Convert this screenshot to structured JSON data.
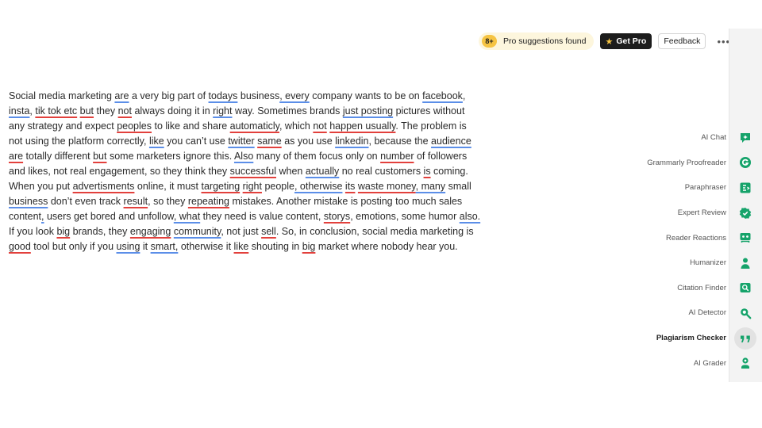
{
  "topbar": {
    "pro_count": "8+",
    "pro_text": "Pro suggestions found",
    "get_pro": "Get Pro",
    "feedback": "Feedback",
    "more": "•••"
  },
  "document": {
    "lines": [
      [
        {
          "t": "Social media marketing "
        },
        {
          "t": "are",
          "u": "b"
        },
        {
          "t": " a very big part of "
        },
        {
          "t": "todays",
          "u": "b"
        },
        {
          "t": " business"
        },
        {
          "t": ", every",
          "u": "b"
        },
        {
          "t": " company wants to be on "
        },
        {
          "t": "facebook",
          "u": "b"
        },
        {
          "t": ","
        }
      ],
      [
        {
          "t": "insta",
          "u": "b"
        },
        {
          "t": ", "
        },
        {
          "t": "tik tok etc",
          "u": "r"
        },
        {
          "t": " "
        },
        {
          "t": "but",
          "u": "r"
        },
        {
          "t": " they "
        },
        {
          "t": "not",
          "u": "r"
        },
        {
          "t": " always doing it in "
        },
        {
          "t": "right",
          "u": "b"
        },
        {
          "t": " way. Sometimes brands "
        },
        {
          "t": "just posting",
          "u": "b"
        },
        {
          "t": " pictures without"
        }
      ],
      [
        {
          "t": "any strategy and expect "
        },
        {
          "t": "peoples",
          "u": "r"
        },
        {
          "t": " to like and share "
        },
        {
          "t": "automaticly",
          "u": "r"
        },
        {
          "t": ", which "
        },
        {
          "t": "not",
          "u": "r"
        },
        {
          "t": " "
        },
        {
          "t": "happen usually",
          "u": "r"
        },
        {
          "t": ". The problem is"
        }
      ],
      [
        {
          "t": "not using the platform correctly, "
        },
        {
          "t": "like",
          "u": "b"
        },
        {
          "t": " you can’t use "
        },
        {
          "t": "twitter",
          "u": "b"
        },
        {
          "t": " "
        },
        {
          "t": "same",
          "u": "r"
        },
        {
          "t": " as you use "
        },
        {
          "t": "linkedin",
          "u": "b"
        },
        {
          "t": ", because the "
        },
        {
          "t": "audience",
          "u": "b"
        }
      ],
      [
        {
          "t": "are",
          "u": "r"
        },
        {
          "t": " totally different "
        },
        {
          "t": "but",
          "u": "r"
        },
        {
          "t": " some marketers ignore this. "
        },
        {
          "t": "Also",
          "u": "b"
        },
        {
          "t": " many of them focus only on "
        },
        {
          "t": "number",
          "u": "r"
        },
        {
          "t": " of followers"
        }
      ],
      [
        {
          "t": "and likes, not real engagement, so they think they "
        },
        {
          "t": "successful",
          "u": "r"
        },
        {
          "t": " when "
        },
        {
          "t": "actually",
          "u": "b"
        },
        {
          "t": " no real customers "
        },
        {
          "t": "is",
          "u": "r"
        },
        {
          "t": " coming."
        }
      ],
      [
        {
          "t": "When you put "
        },
        {
          "t": "advertisments",
          "u": "r"
        },
        {
          "t": " online, it must "
        },
        {
          "t": "targeting",
          "u": "r"
        },
        {
          "t": " "
        },
        {
          "t": "right",
          "u": "r"
        },
        {
          "t": " people"
        },
        {
          "t": ", otherwise",
          "u": "b"
        },
        {
          "t": " "
        },
        {
          "t": "its",
          "u": "r"
        },
        {
          "t": " "
        },
        {
          "t": "waste money",
          "u": "r"
        },
        {
          "t": ", many",
          "u": "b"
        },
        {
          "t": " small"
        }
      ],
      [
        {
          "t": "business",
          "u": "b"
        },
        {
          "t": " don’t even track "
        },
        {
          "t": "result",
          "u": "r"
        },
        {
          "t": ", so they "
        },
        {
          "t": "repeating",
          "u": "r"
        },
        {
          "t": " mistakes. Another mistake is posting too much sales"
        }
      ],
      [
        {
          "t": "content"
        },
        {
          "t": ",",
          "u": "b"
        },
        {
          "t": " users get bored and unfollow"
        },
        {
          "t": ", what",
          "u": "b"
        },
        {
          "t": " they need is value content, "
        },
        {
          "t": "storys",
          "u": "r"
        },
        {
          "t": ", emotions, some humor "
        },
        {
          "t": "also.",
          "u": "b"
        }
      ],
      [
        {
          "t": "If you look "
        },
        {
          "t": "big",
          "u": "r"
        },
        {
          "t": " brands, they "
        },
        {
          "t": "engaging",
          "u": "r"
        },
        {
          "t": " "
        },
        {
          "t": "community",
          "u": "b"
        },
        {
          "t": ", not just "
        },
        {
          "t": "sell",
          "u": "r"
        },
        {
          "t": ". So, in conclusion, social media marketing is"
        }
      ],
      [
        {
          "t": "good",
          "u": "r"
        },
        {
          "t": " tool but only if you "
        },
        {
          "t": "using",
          "u": "b"
        },
        {
          "t": " it "
        },
        {
          "t": "smart,",
          "u": "b"
        },
        {
          "t": " otherwise it "
        },
        {
          "t": "like",
          "u": "r"
        },
        {
          "t": " shouting in "
        },
        {
          "t": "big",
          "u": "r"
        },
        {
          "t": " market where nobody hear you."
        }
      ]
    ]
  },
  "colors": {
    "error_underline": "#e2403c",
    "suggestion_underline": "#5b8ee8",
    "accent_green": "#15a36a"
  },
  "sidebar": {
    "items": [
      {
        "label": "AI Chat",
        "icon": "chat-icon",
        "active": false
      },
      {
        "label": "Grammarly Proofreader",
        "icon": "grammarly-icon",
        "active": false
      },
      {
        "label": "Paraphraser",
        "icon": "paraphraser-icon",
        "active": false
      },
      {
        "label": "Expert Review",
        "icon": "badge-check-icon",
        "active": false
      },
      {
        "label": "Reader Reactions",
        "icon": "reader-reactions-icon",
        "active": false
      },
      {
        "label": "Humanizer",
        "icon": "person-icon",
        "active": false
      },
      {
        "label": "Citation Finder",
        "icon": "citation-icon",
        "active": false
      },
      {
        "label": "AI Detector",
        "icon": "magnifier-icon",
        "active": false
      },
      {
        "label": "Plagiarism Checker",
        "icon": "quote-icon",
        "active": true
      },
      {
        "label": "AI Grader",
        "icon": "grader-icon",
        "active": false
      }
    ]
  }
}
